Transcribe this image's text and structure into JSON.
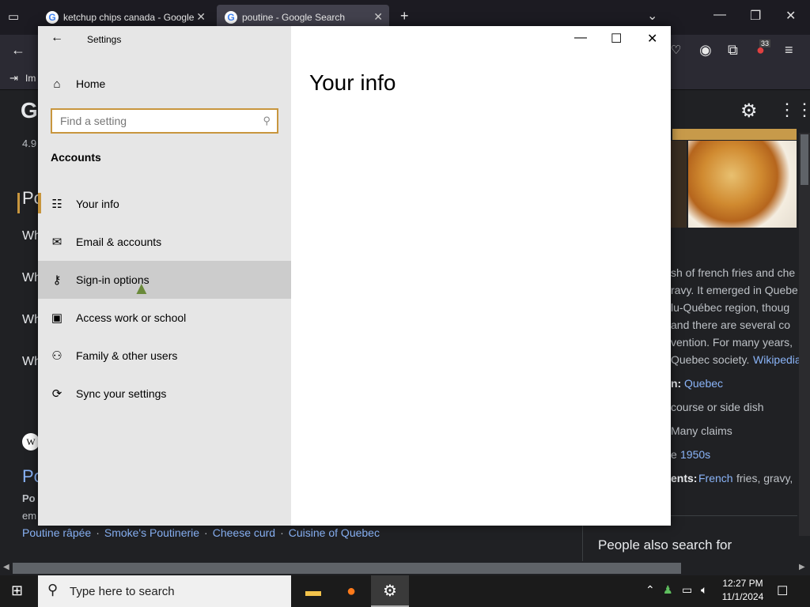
{
  "browser": {
    "tabs": [
      {
        "title": "ketchup chips canada - Google"
      },
      {
        "title": "poutine - Google Search"
      }
    ],
    "bookmark_label": "Im",
    "notification_count": "33"
  },
  "google_page": {
    "logo_partial": "G",
    "rating_partial": "4.9",
    "heading_partial": "Pc",
    "faq_items": [
      "Wh",
      "Wh",
      "Wh",
      "Wh"
    ],
    "wiki_title_partial": "Po",
    "wiki_bold_partial": "Po",
    "wiki_text_partial": "em",
    "related_links": [
      "Poutine râpée",
      "Smoke's Poutinerie",
      "Cheese curd",
      "Cuisine of Quebec"
    ],
    "related_sep": "·",
    "kp_lines": [
      "sh of french fries and che",
      "ravy. It emerged in Quebe",
      "lu-Québec region, thoug",
      "and there are several co",
      "vention. For many years,",
      "Quebec society."
    ],
    "kp_wiki_link": "Wikipedia",
    "kp_origin_label": "n:",
    "kp_origin_value": "Quebec",
    "kp_course": "course or side dish",
    "kp_claims": "Many claims",
    "kp_created_prefix": "e",
    "kp_created_value": "1950s",
    "kp_ingredients_label": "ents:",
    "kp_ingredients_link": "French",
    "kp_ingredients_rest": "fries, gravy,",
    "people_also_search": "People also search for"
  },
  "settings": {
    "window_title": "Settings",
    "home_label": "Home",
    "search_placeholder": "Find a setting",
    "section_heading": "Accounts",
    "nav_items": [
      {
        "label": "Your info",
        "icon": "person-card-icon"
      },
      {
        "label": "Email & accounts",
        "icon": "mail-icon"
      },
      {
        "label": "Sign-in options",
        "icon": "key-icon"
      },
      {
        "label": "Access work or school",
        "icon": "briefcase-icon"
      },
      {
        "label": "Family & other users",
        "icon": "add-person-icon"
      },
      {
        "label": "Sync your settings",
        "icon": "sync-icon"
      }
    ],
    "selected_item": "Your info",
    "hovered_item": "Sign-in options",
    "page_title": "Your info"
  },
  "taskbar": {
    "search_placeholder": "Type here to search",
    "time": "12:27 PM",
    "date": "11/1/2024"
  },
  "colors": {
    "accent": "#c8963e",
    "side_bg": "#e6e6e6",
    "hover_bg": "#cccccc"
  }
}
